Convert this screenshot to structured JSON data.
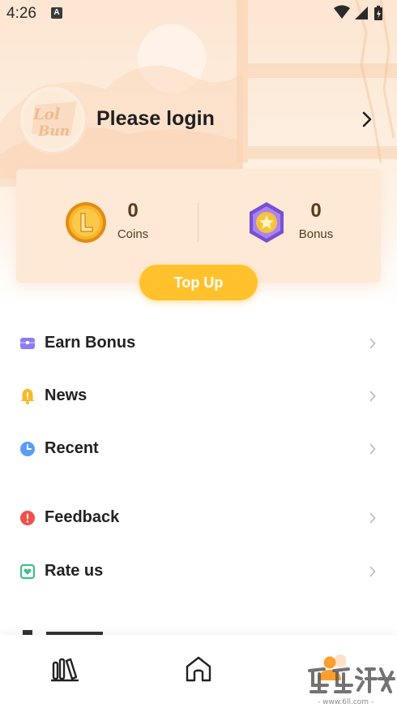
{
  "status_bar": {
    "time": "4:26",
    "notification_icon": "a-badge-icon",
    "icons": [
      "wifi-icon",
      "signal-icon",
      "battery-icon"
    ]
  },
  "profile": {
    "avatar_icon": "lolebum-logo-icon",
    "login_text": "Please login",
    "arrow_icon": "chevron-right-icon"
  },
  "wallet": {
    "coins": {
      "value": "0",
      "label": "Coins",
      "icon": "coin-icon"
    },
    "bonus": {
      "value": "0",
      "label": "Bonus",
      "icon": "bonus-star-icon"
    },
    "topup_label": "Top Up"
  },
  "menu": [
    {
      "label": "Earn Bonus",
      "icon": "treasure-box-icon",
      "color": "#8b7cf6"
    },
    {
      "label": "News",
      "icon": "bell-icon",
      "color": "#f7b928"
    },
    {
      "label": "Recent",
      "icon": "clock-icon",
      "color": "#5b9cf6"
    },
    {
      "label": "Feedback",
      "icon": "alert-icon",
      "color": "#f0524c"
    },
    {
      "label": "Rate us",
      "icon": "rate-heart-icon",
      "color": "#3fbf8a"
    }
  ],
  "tabbar": {
    "tabs": [
      "bookshelf-icon",
      "home-icon",
      "profile-icon"
    ],
    "active_color": "#ff9f2e"
  },
  "colors": {
    "accent": "#ffc22c",
    "wallet_bg": "#fde9d5",
    "wallet_text": "#5a3a1e"
  }
}
